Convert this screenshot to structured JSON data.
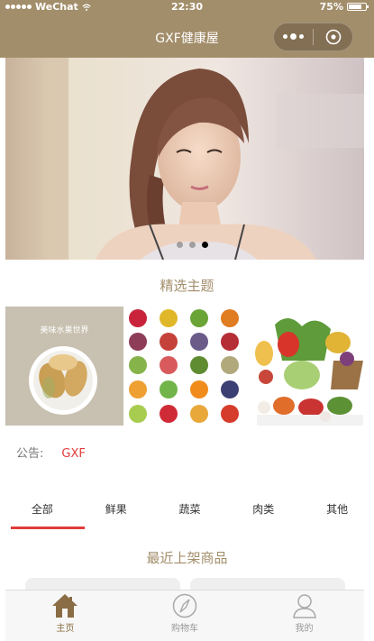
{
  "status_bar": {
    "carrier": "WeChat",
    "time": "22:30",
    "battery": "75%",
    "battery_level": 0.75
  },
  "nav": {
    "title": "GXF健康屋"
  },
  "banner": {
    "dot_count": 3,
    "active_dot": 3
  },
  "featured": {
    "title": "精选主题",
    "theme_label": "美味水果世界"
  },
  "notice": {
    "label": "公告:",
    "value": "GXF"
  },
  "tabs": [
    {
      "label": "全部",
      "active": true
    },
    {
      "label": "鲜果",
      "active": false
    },
    {
      "label": "蔬菜",
      "active": false
    },
    {
      "label": "肉类",
      "active": false
    },
    {
      "label": "其他",
      "active": false
    }
  ],
  "recent": {
    "title": "最近上架商品"
  },
  "tabbar": [
    {
      "label": "主页",
      "icon": "home-icon",
      "active": true
    },
    {
      "label": "购物车",
      "icon": "compass-icon",
      "active": false
    },
    {
      "label": "我的",
      "icon": "user-icon",
      "active": false
    }
  ],
  "colors": {
    "brand": "#a38e6b",
    "accent": "#e23b3b"
  }
}
